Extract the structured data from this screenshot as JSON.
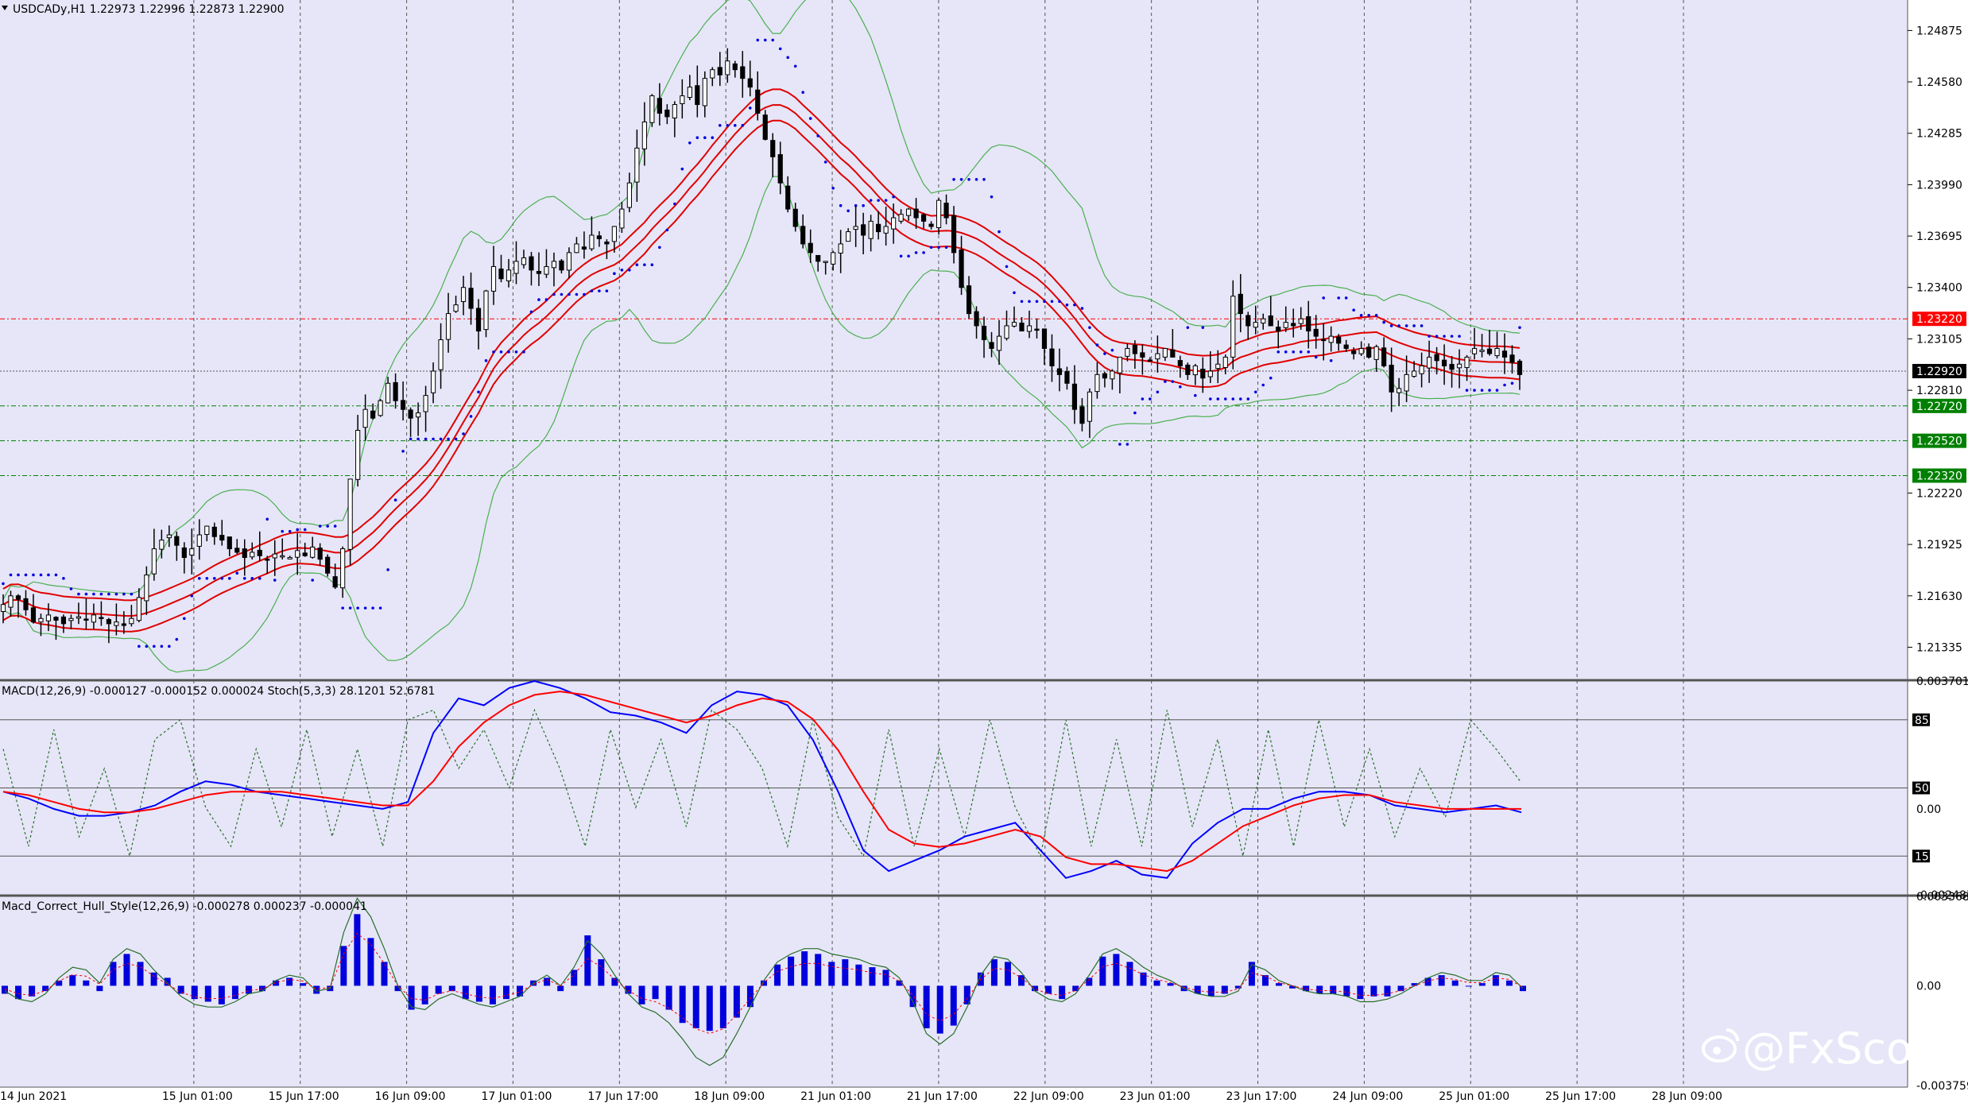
{
  "colors": {
    "background": "#e6e6f8",
    "grid": "#555555",
    "candle_bull": "#ffffff",
    "candle_bear": "#000000",
    "envelope": "#e00000",
    "bollinger": "#4caf50",
    "psar": "#0000e0",
    "macd_main": "#0000ff",
    "macd_signal": "#ff0000",
    "stoch": "#2a6e2a",
    "hist": "#0000dd",
    "level_red": "#ff0000",
    "level_green": "#008000"
  },
  "header": {
    "main": "USDCADy,H1  1.22973 1.22996 1.22873 1.22900",
    "osc1": "MACD(12,26,9) -0.000127 -0.000152 0.000024  Stoch(5,3,3) 28.1201 52.6781",
    "osc2": "Macd_Correct_Hull_Style(12,26,9) -0.000278 0.000237 -0.000041"
  },
  "watermark": "@FxScotty",
  "icons": {
    "watermark": "weibo-icon",
    "menu": "dropdown-arrow-icon"
  },
  "chart_data": [
    {
      "type": "candlestick",
      "symbol": "USDCADy",
      "timeframe": "H1",
      "ylim": [
        1.2115,
        1.2505
      ],
      "y_ticks": [
        "1.24875",
        "1.24580",
        "1.24285",
        "1.23990",
        "1.23695",
        "1.23400",
        "1.23105",
        "1.22810",
        "1.22220",
        "1.21925",
        "1.21630",
        "1.21335"
      ],
      "x_ticks": [
        "14 Jun 2021",
        "15 Jun 01:00",
        "15 Jun 17:00",
        "16 Jun 09:00",
        "17 Jun 01:00",
        "17 Jun 17:00",
        "18 Jun 09:00",
        "21 Jun 01:00",
        "21 Jun 17:00",
        "22 Jun 09:00",
        "23 Jun 01:00",
        "23 Jun 17:00",
        "24 Jun 09:00",
        "25 Jun 01:00",
        "25 Jun 17:00",
        "28 Jun 09:00"
      ],
      "current_price": "1.22920",
      "levels": [
        {
          "value": 1.2322,
          "label": "1.23220",
          "color": "red"
        },
        {
          "value": 1.2272,
          "label": "1.22720",
          "color": "green"
        },
        {
          "value": 1.2252,
          "label": "1.22520",
          "color": "green"
        },
        {
          "value": 1.2232,
          "label": "1.22320",
          "color": "green"
        }
      ],
      "closes": [
        1.2158,
        1.2163,
        1.2161,
        1.2155,
        1.2148,
        1.215,
        1.2152,
        1.2149,
        1.2147,
        1.215,
        1.2151,
        1.2149,
        1.2152,
        1.215,
        1.2147,
        1.2148,
        1.2146,
        1.215,
        1.2162,
        1.2175,
        1.219,
        1.2195,
        1.2198,
        1.2192,
        1.2185,
        1.219,
        1.2198,
        1.2203,
        1.2197,
        1.2195,
        1.219,
        1.2188,
        1.2185,
        1.2188,
        1.2186,
        1.2184,
        1.2187,
        1.2186,
        1.2185,
        1.2189,
        1.2186,
        1.2191,
        1.2184,
        1.2176,
        1.2168,
        1.219,
        1.223,
        1.2258,
        1.227,
        1.2265,
        1.2275,
        1.2285,
        1.2275,
        1.227,
        1.2265,
        1.2268,
        1.2278,
        1.2292,
        1.231,
        1.2325,
        1.233,
        1.234,
        1.2328,
        1.2315,
        1.2338,
        1.2352,
        1.2345,
        1.235,
        1.2355,
        1.2357,
        1.235,
        1.2348,
        1.2352,
        1.2355,
        1.235,
        1.236,
        1.2365,
        1.2362,
        1.237,
        1.2368,
        1.2365,
        1.2375,
        1.2385,
        1.24,
        1.242,
        1.2435,
        1.245,
        1.244,
        1.2438,
        1.2445,
        1.245,
        1.2455,
        1.2445,
        1.246,
        1.2465,
        1.2462,
        1.247,
        1.2465,
        1.246,
        1.2455,
        1.244,
        1.2425,
        1.2415,
        1.24,
        1.2385,
        1.2375,
        1.2365,
        1.236,
        1.2355,
        1.2355,
        1.236,
        1.2365,
        1.2372,
        1.2375,
        1.237,
        1.2378,
        1.2372,
        1.2375,
        1.238,
        1.2382,
        1.2385,
        1.238,
        1.2378,
        1.2375,
        1.239,
        1.238,
        1.236,
        1.234,
        1.2325,
        1.2318,
        1.231,
        1.2305,
        1.2312,
        1.2318,
        1.232,
        1.2315,
        1.2318,
        1.2316,
        1.2305,
        1.2295,
        1.229,
        1.2285,
        1.227,
        1.2262,
        1.228,
        1.229,
        1.2288,
        1.2292,
        1.23,
        1.2305,
        1.2302,
        1.23,
        1.2298,
        1.2302,
        1.2305,
        1.23,
        1.2295,
        1.229,
        1.2295,
        1.2288,
        1.2292,
        1.2296,
        1.23,
        1.2335,
        1.2325,
        1.2318,
        1.232,
        1.2322,
        1.2318,
        1.2315,
        1.232,
        1.2318,
        1.2322,
        1.2315,
        1.2312,
        1.231,
        1.2312,
        1.2308,
        1.2305,
        1.2302,
        1.2305,
        1.23,
        1.2306,
        1.2295,
        1.228,
        1.2282,
        1.229,
        1.2292,
        1.2295,
        1.23,
        1.2298,
        1.2295,
        1.2293,
        1.2296,
        1.23,
        1.2305,
        1.2304,
        1.2302,
        1.2305,
        1.23,
        1.2297,
        1.229
      ]
    },
    {
      "type": "line",
      "name": "MACD(12,26,9) + Stoch(5,3,3)",
      "y_ticks": [
        "0.003701",
        "0.00",
        "-0.002487"
      ],
      "levels": [
        85,
        50,
        15
      ],
      "ylim": [
        -0.002487,
        0.003701
      ],
      "macd_main": [
        0.0005,
        0.0003,
        0.0,
        -0.0002,
        -0.0002,
        -0.0001,
        0.0001,
        0.0005,
        0.0008,
        0.0007,
        0.0005,
        0.0004,
        0.0003,
        0.0002,
        0.0001,
        0.0,
        0.0002,
        0.0022,
        0.0032,
        0.003,
        0.0035,
        0.0037,
        0.0035,
        0.0032,
        0.0028,
        0.0027,
        0.0025,
        0.0022,
        0.003,
        0.0034,
        0.0033,
        0.003,
        0.002,
        0.0005,
        -0.0012,
        -0.0018,
        -0.0015,
        -0.0012,
        -0.0008,
        -0.0006,
        -0.0004,
        -0.0012,
        -0.002,
        -0.0018,
        -0.0015,
        -0.0019,
        -0.002,
        -0.001,
        -0.0004,
        0.0,
        0.0,
        0.0003,
        0.0005,
        0.0005,
        0.0004,
        0.0001,
        0.0,
        -0.0001,
        0.0,
        0.0001,
        -0.0001
      ],
      "macd_signal": [
        0.0005,
        0.0004,
        0.0002,
        0.0,
        -0.0001,
        -0.0001,
        0.0,
        0.0002,
        0.0004,
        0.0005,
        0.0005,
        0.0005,
        0.0004,
        0.0003,
        0.0002,
        0.0001,
        0.0001,
        0.0008,
        0.0018,
        0.0025,
        0.003,
        0.0033,
        0.0034,
        0.0033,
        0.0031,
        0.0029,
        0.0027,
        0.0025,
        0.0027,
        0.003,
        0.0032,
        0.0031,
        0.0026,
        0.0017,
        0.0005,
        -0.0006,
        -0.001,
        -0.0011,
        -0.001,
        -0.0008,
        -0.0006,
        -0.0008,
        -0.0014,
        -0.0016,
        -0.0016,
        -0.0017,
        -0.0018,
        -0.0015,
        -0.001,
        -0.0005,
        -0.0002,
        0.0001,
        0.0003,
        0.0004,
        0.0004,
        0.0002,
        0.0001,
        0.0,
        0.0,
        0.0,
        0.0
      ],
      "stoch": [
        70,
        20,
        80,
        25,
        60,
        15,
        75,
        85,
        40,
        20,
        70,
        30,
        80,
        25,
        70,
        20,
        85,
        90,
        60,
        80,
        50,
        90,
        60,
        20,
        80,
        40,
        75,
        30,
        90,
        80,
        60,
        20,
        85,
        35,
        15,
        80,
        20,
        70,
        25,
        85,
        40,
        15,
        85,
        20,
        75,
        20,
        90,
        30,
        75,
        15,
        80,
        20,
        85,
        30,
        70,
        25,
        60,
        35,
        85,
        70,
        52.68
      ]
    },
    {
      "type": "bar",
      "name": "Macd_Correct_Hull_Style(12,26,9)",
      "y_ticks": [
        "0.003368",
        "0.00",
        "-0.003759"
      ],
      "ylim": [
        -0.003759,
        0.003368
      ],
      "histogram": [
        -0.0003,
        -0.0005,
        -0.0004,
        -0.0002,
        0.0002,
        0.0004,
        0.0002,
        -0.0002,
        0.0009,
        0.0012,
        0.0009,
        0.0005,
        0.0003,
        -0.0003,
        -0.0005,
        -0.0006,
        -0.0007,
        -0.0005,
        -0.0003,
        -0.0002,
        0.0002,
        0.0003,
        0.0001,
        -0.0003,
        -0.0002,
        0.0015,
        0.0027,
        0.0018,
        0.0009,
        -0.0002,
        -0.0009,
        -0.0007,
        -0.0003,
        -0.0002,
        -0.0005,
        -0.0006,
        -0.0007,
        -0.0005,
        -0.0004,
        0.0002,
        0.0003,
        -0.0002,
        0.0006,
        0.0019,
        0.001,
        0.0003,
        -0.0003,
        -0.0007,
        -0.0005,
        -0.0009,
        -0.0014,
        -0.0016,
        -0.0017,
        -0.0016,
        -0.0012,
        -0.0008,
        0.0002,
        0.0008,
        0.0011,
        0.0013,
        0.0012,
        0.0009,
        0.001,
        0.0008,
        0.0007,
        0.0006,
        0.0002,
        -0.0008,
        -0.0016,
        -0.0018,
        -0.0015,
        -0.0007,
        0.0005,
        0.001,
        0.0009,
        0.0004,
        -0.0002,
        -0.0003,
        -0.0005,
        -0.0002,
        0.0003,
        0.0011,
        0.0012,
        0.0009,
        0.0005,
        0.0002,
        0.0001,
        -0.0002,
        -0.0003,
        -0.0004,
        -0.0003,
        -0.0001,
        0.0009,
        0.0004,
        0.0001,
        -0.0001,
        -0.0002,
        -0.0003,
        -0.0003,
        -0.0004,
        -0.0005,
        -0.0004,
        -0.0004,
        -0.0002,
        0.0001,
        0.0003,
        0.0004,
        0.0002,
        0.0,
        0.0001,
        0.0004,
        0.0002,
        -0.0002
      ],
      "signal": [
        -0.0002,
        -0.0005,
        -0.0006,
        -0.0003,
        0.0003,
        0.0007,
        0.0006,
        0.0001,
        0.001,
        0.0014,
        0.0012,
        0.0006,
        0.0001,
        -0.0004,
        -0.0007,
        -0.0008,
        -0.0008,
        -0.0006,
        -0.0003,
        -0.0002,
        0.0002,
        0.0004,
        0.0003,
        -0.0002,
        -0.0001,
        0.002,
        0.0033,
        0.0026,
        0.0014,
        0.0,
        -0.0008,
        -0.0009,
        -0.0005,
        -0.0003,
        -0.0005,
        -0.0007,
        -0.0008,
        -0.0006,
        -0.0004,
        0.0001,
        0.0004,
        0.0,
        0.0007,
        0.0017,
        0.0012,
        0.0004,
        -0.0003,
        -0.0008,
        -0.001,
        -0.0014,
        -0.002,
        -0.0027,
        -0.003,
        -0.0027,
        -0.0018,
        -0.0008,
        0.0002,
        0.0009,
        0.0012,
        0.0014,
        0.0014,
        0.0012,
        0.0011,
        0.001,
        0.0008,
        0.0007,
        0.0003,
        -0.0006,
        -0.0018,
        -0.0022,
        -0.0018,
        -0.0008,
        0.0004,
        0.0011,
        0.001,
        0.0005,
        -0.0002,
        -0.0005,
        -0.0006,
        -0.0003,
        0.0004,
        0.0012,
        0.0014,
        0.0011,
        0.0007,
        0.0004,
        0.0002,
        -0.0001,
        -0.0003,
        -0.0004,
        -0.0004,
        -0.0002,
        0.0008,
        0.0006,
        0.0002,
        0.0,
        -0.0002,
        -0.0003,
        -0.0003,
        -0.0004,
        -0.0006,
        -0.0006,
        -0.0005,
        -0.0003,
        0.0,
        0.0003,
        0.0005,
        0.0004,
        0.0002,
        0.0002,
        0.0005,
        0.0004,
        -0.0001
      ]
    }
  ]
}
